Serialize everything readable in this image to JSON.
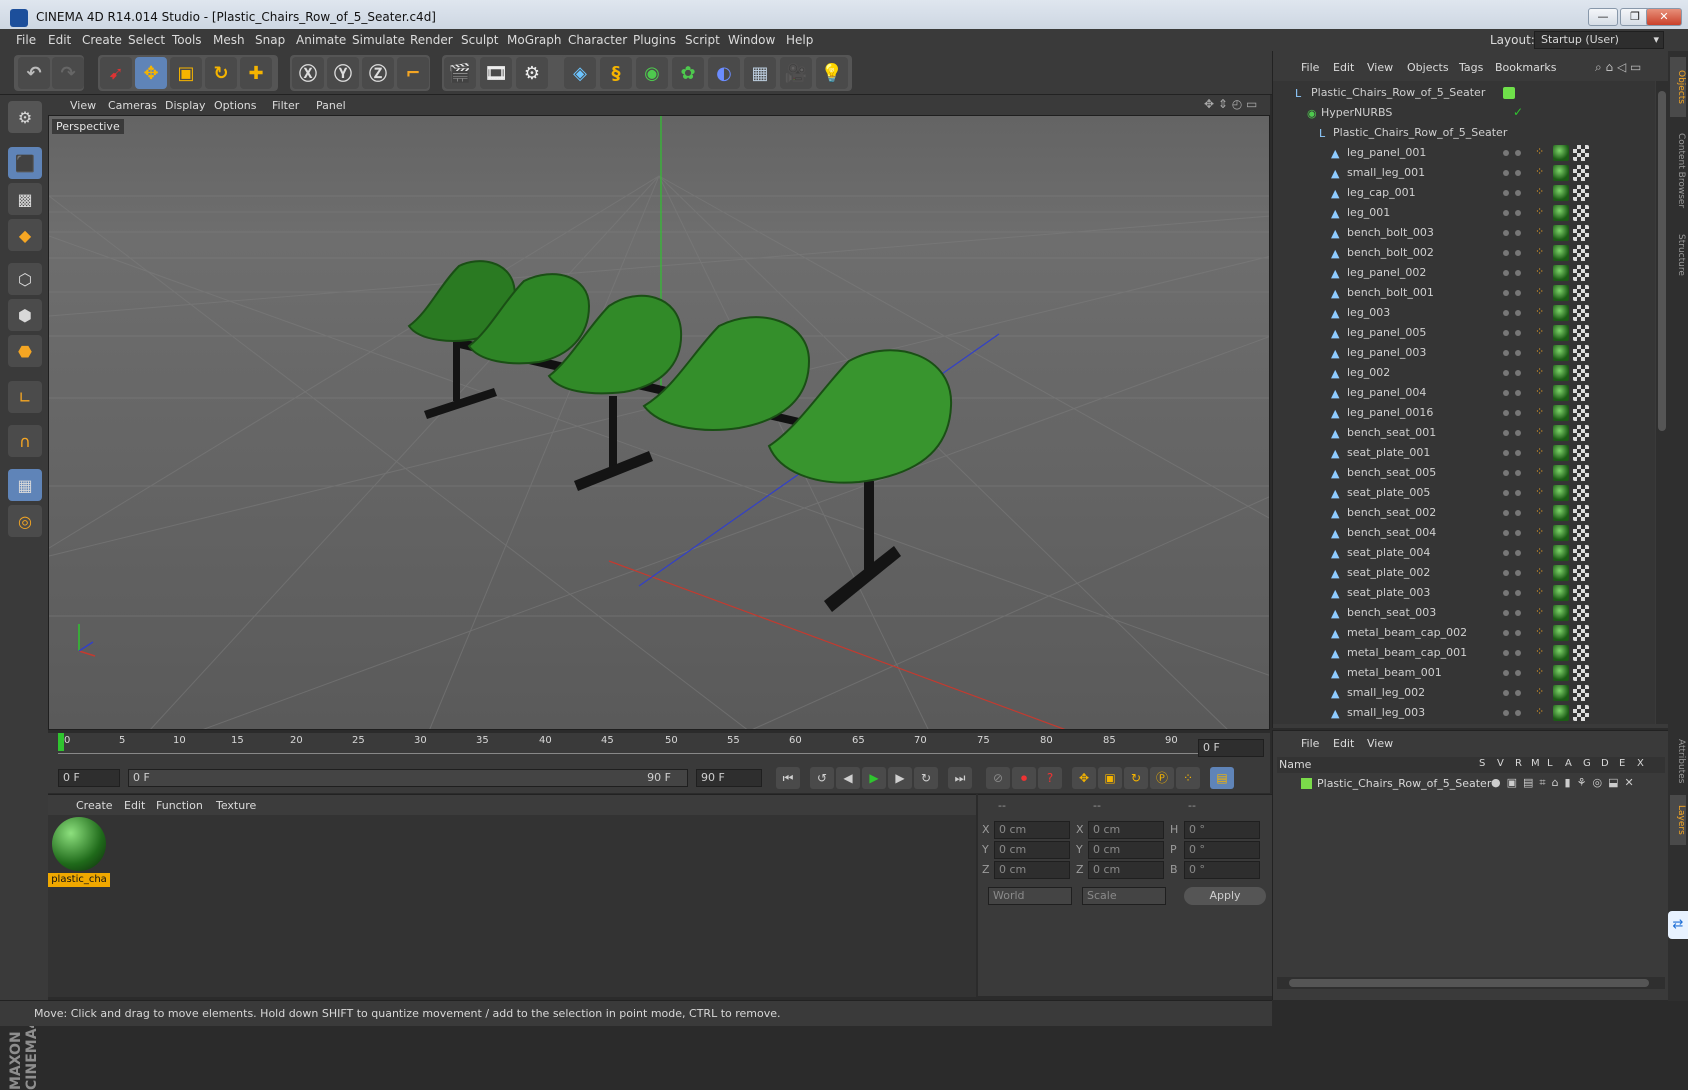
{
  "window": {
    "title": "CINEMA 4D R14.014 Studio - [Plastic_Chairs_Row_of_5_Seater.c4d]",
    "buttons": [
      "—",
      "❐",
      "✕"
    ]
  },
  "menubar": {
    "items": [
      "File",
      "Edit",
      "Create",
      "Select",
      "Tools",
      "Mesh",
      "Snap",
      "Animate",
      "Simulate",
      "Render",
      "Sculpt",
      "MoGraph",
      "Character",
      "Plugins",
      "Script",
      "Window",
      "Help"
    ],
    "layout_label": "Layout:",
    "layout_value": "Startup (User)"
  },
  "viewport": {
    "menu": [
      "View",
      "Cameras",
      "Display",
      "Options",
      "Filter",
      "Panel"
    ],
    "label": "Perspective",
    "accent_green": "#2f8a2a",
    "background": "#646464"
  },
  "timeline": {
    "ticks": [
      "0",
      "5",
      "10",
      "15",
      "20",
      "25",
      "30",
      "35",
      "40",
      "45",
      "50",
      "55",
      "60",
      "65",
      "70",
      "75",
      "80",
      "85",
      "90"
    ],
    "current_frame": "0 F"
  },
  "transport": {
    "start_field": "0 F",
    "range_start": "0 F",
    "range_end": "90 F",
    "end_field": "90 F"
  },
  "material_manager": {
    "menu": [
      "Create",
      "Edit",
      "Function",
      "Texture"
    ],
    "materials": [
      {
        "name": "plastic_cha"
      }
    ]
  },
  "coordinates": {
    "headers": [
      "--",
      "--",
      "--"
    ],
    "rows": [
      {
        "a": "X",
        "av": "0 cm",
        "b": "X",
        "bv": "0 cm",
        "c": "H",
        "cv": "0 °"
      },
      {
        "a": "Y",
        "av": "0 cm",
        "b": "Y",
        "bv": "0 cm",
        "c": "P",
        "cv": "0 °"
      },
      {
        "a": "Z",
        "av": "0 cm",
        "b": "Z",
        "bv": "0 cm",
        "c": "B",
        "cv": "0 °"
      }
    ],
    "world": "World",
    "scale": "Scale",
    "apply": "Apply"
  },
  "status": {
    "text": "Move: Click and drag to move elements. Hold down SHIFT to quantize movement / add to the selection in point mode, CTRL to remove."
  },
  "object_manager": {
    "menu": [
      "File",
      "Edit",
      "View",
      "Objects",
      "Tags",
      "Bookmarks"
    ],
    "root": "Plastic_Chairs_Row_of_5_Seater",
    "hypernurbs": "HyperNURBS",
    "group": "Plastic_Chairs_Row_of_5_Seater",
    "objects": [
      "leg_panel_001",
      "small_leg_001",
      "leg_cap_001",
      "leg_001",
      "bench_bolt_003",
      "bench_bolt_002",
      "leg_panel_002",
      "bench_bolt_001",
      "leg_003",
      "leg_panel_005",
      "leg_panel_003",
      "leg_002",
      "leg_panel_004",
      "leg_panel_0016",
      "bench_seat_001",
      "seat_plate_001",
      "bench_seat_005",
      "seat_plate_005",
      "bench_seat_002",
      "bench_seat_004",
      "seat_plate_004",
      "seat_plate_002",
      "seat_plate_003",
      "bench_seat_003",
      "metal_beam_cap_002",
      "metal_beam_cap_001",
      "metal_beam_001",
      "small_leg_002",
      "small_leg_003"
    ]
  },
  "layer_manager": {
    "menu": [
      "File",
      "Edit",
      "View"
    ],
    "header_name": "Name",
    "header_flags": [
      "S",
      "V",
      "R",
      "M",
      "L",
      "A",
      "G",
      "D",
      "E",
      "X"
    ],
    "layers": [
      {
        "name": "Plastic_Chairs_Row_of_5_Seater",
        "color": "#7bdc4a"
      }
    ]
  },
  "right_tabs": [
    "Objects",
    "Content Browser",
    "Structure",
    "Attributes",
    "Layers"
  ]
}
